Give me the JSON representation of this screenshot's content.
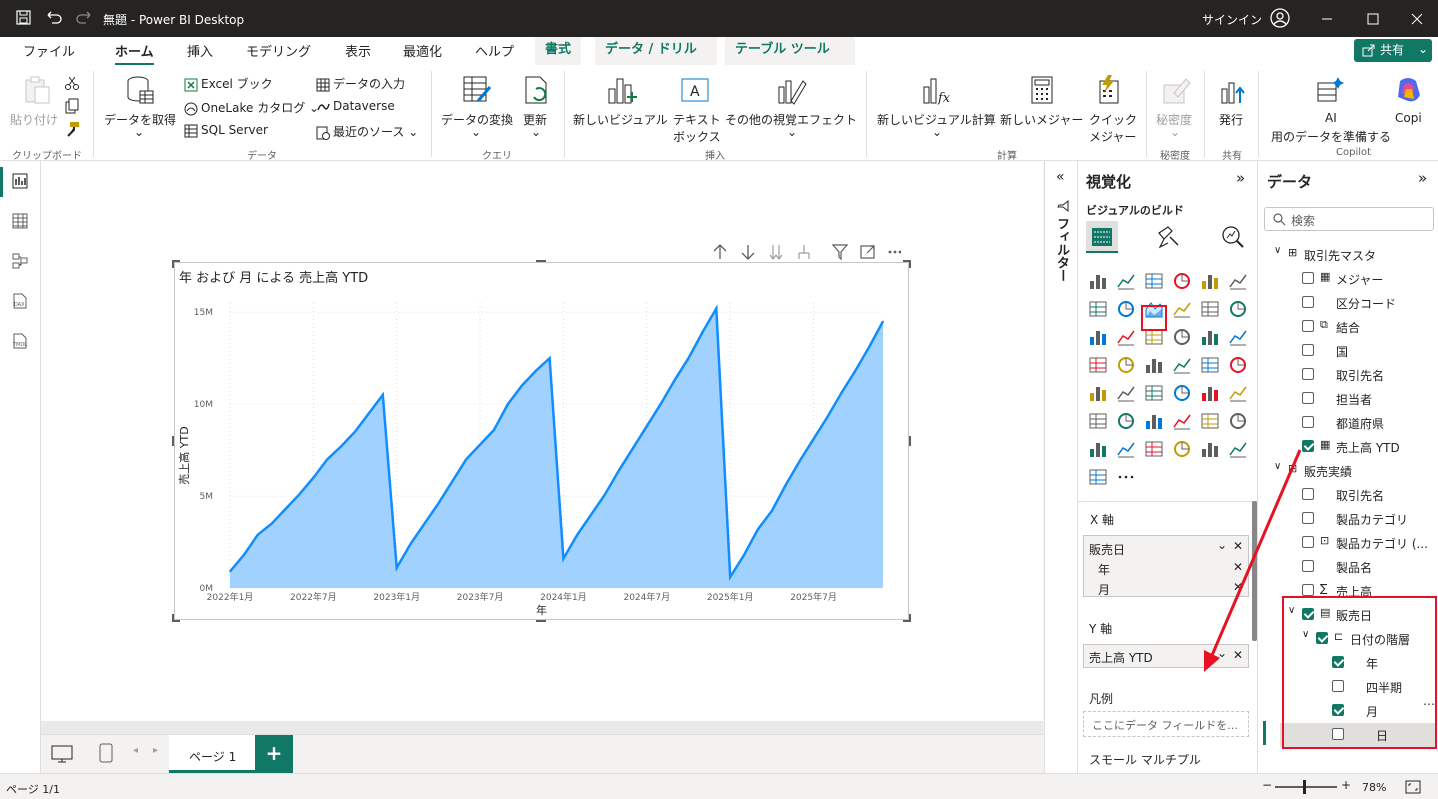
{
  "titlebar": {
    "title": "無題 - Power BI Desktop",
    "signin": "サインイン"
  },
  "tabs": {
    "file": "ファイル",
    "home": "ホーム",
    "insert": "挿入",
    "modeling": "モデリング",
    "view": "表示",
    "optimize": "最適化",
    "help": "ヘルプ",
    "format": "書式",
    "data_drill": "データ / ドリル",
    "table_tools": "テーブル ツール",
    "share": "共有"
  },
  "ribbon": {
    "paste": "貼り付け",
    "clipboard": "クリップボード",
    "get_data": "データを取得",
    "excel": "Excel ブック",
    "onelake": "OneLake カタログ",
    "sql": "SQL Server",
    "enter_data": "データの入力",
    "dataverse": "Dataverse",
    "recent": "最近のソース",
    "data_group": "データ",
    "transform": "データの変換",
    "refresh": "更新",
    "query_group": "クエリ",
    "new_visual": "新しいビジュアル",
    "textbox_1": "テキスト",
    "textbox_2": "ボックス",
    "more_visuals": "その他の視覚エフェクト",
    "insert_group": "挿入",
    "new_calc": "新しいビジュアル計算",
    "new_measure": "新しいメジャー",
    "quick_1": "クイック",
    "quick_2": "メジャー",
    "calc_group": "計算",
    "sensitivity": "秘密度",
    "sensitivity_group": "秘密度",
    "publish": "発行",
    "share_group": "共有",
    "ai_1": "AI",
    "ai_2": "用のデータを準備する",
    "copilot": "Copi",
    "copilot_group": "Copilot"
  },
  "chart_title": "年 および 月 による 売上高 YTD",
  "chart_data": {
    "type": "area",
    "title": "年 および 月 による 売上高 YTD",
    "xlabel": "年",
    "ylabel": "売上高 YTD",
    "y_ticks": [
      "0M",
      "5M",
      "10M",
      "15M"
    ],
    "x_ticks": [
      "2022年1月",
      "2022年7月",
      "2023年1月",
      "2023年7月",
      "2024年1月",
      "2024年7月",
      "2025年1月",
      "2025年7月"
    ],
    "ylim": [
      0,
      15.5
    ],
    "series": [
      {
        "values": [
          0.9,
          1.8,
          2.9,
          3.5,
          4.3,
          5.1,
          6.0,
          7.0,
          7.7,
          8.5,
          9.5,
          10.5,
          1.1,
          2.4,
          3.5,
          4.6,
          5.8,
          7.0,
          7.8,
          8.6,
          10.0,
          11.0,
          11.8,
          12.5,
          1.6,
          2.9,
          4.0,
          5.1,
          6.4,
          7.6,
          8.8,
          10.0,
          11.3,
          12.5,
          13.9,
          15.2,
          0.6,
          1.8,
          3.2,
          4.2,
          5.6,
          6.9,
          8.1,
          9.3,
          10.6,
          11.8,
          13.1,
          14.5
        ]
      }
    ],
    "grid": true
  },
  "filters": {
    "label": "フィルター"
  },
  "vis_pane": {
    "title": "視覚化",
    "build": "ビジュアルのビルド",
    "x_axis": "X 軸",
    "x_field": "販売日",
    "x_sub1": "年",
    "x_sub2": "月",
    "y_axis": "Y 軸",
    "y_field": "売上高 YTD",
    "legend": "凡例",
    "legend_placeholder": "ここにデータ フィールドを...",
    "small_multiples": "スモール マルチプル"
  },
  "data_pane": {
    "title": "データ",
    "search_placeholder": "検索",
    "table1": "取引先マスタ",
    "table1_fields": [
      "メジャー",
      "区分コード",
      "結合",
      "国",
      "取引先名",
      "担当者",
      "都道府県",
      "売上高 YTD"
    ],
    "table2": "販売実績",
    "table2_fields": [
      "取引先名",
      "製品カテゴリ",
      "製品カテゴリ (...",
      "製品名",
      "売上高"
    ],
    "date_field": "販売日",
    "hierarchy": "日付の階層",
    "hier_items": [
      "年",
      "四半期",
      "月",
      "日"
    ]
  },
  "bottom": {
    "page1": "ページ 1"
  },
  "status": {
    "page": "ページ 1/1",
    "zoom": "78%"
  }
}
